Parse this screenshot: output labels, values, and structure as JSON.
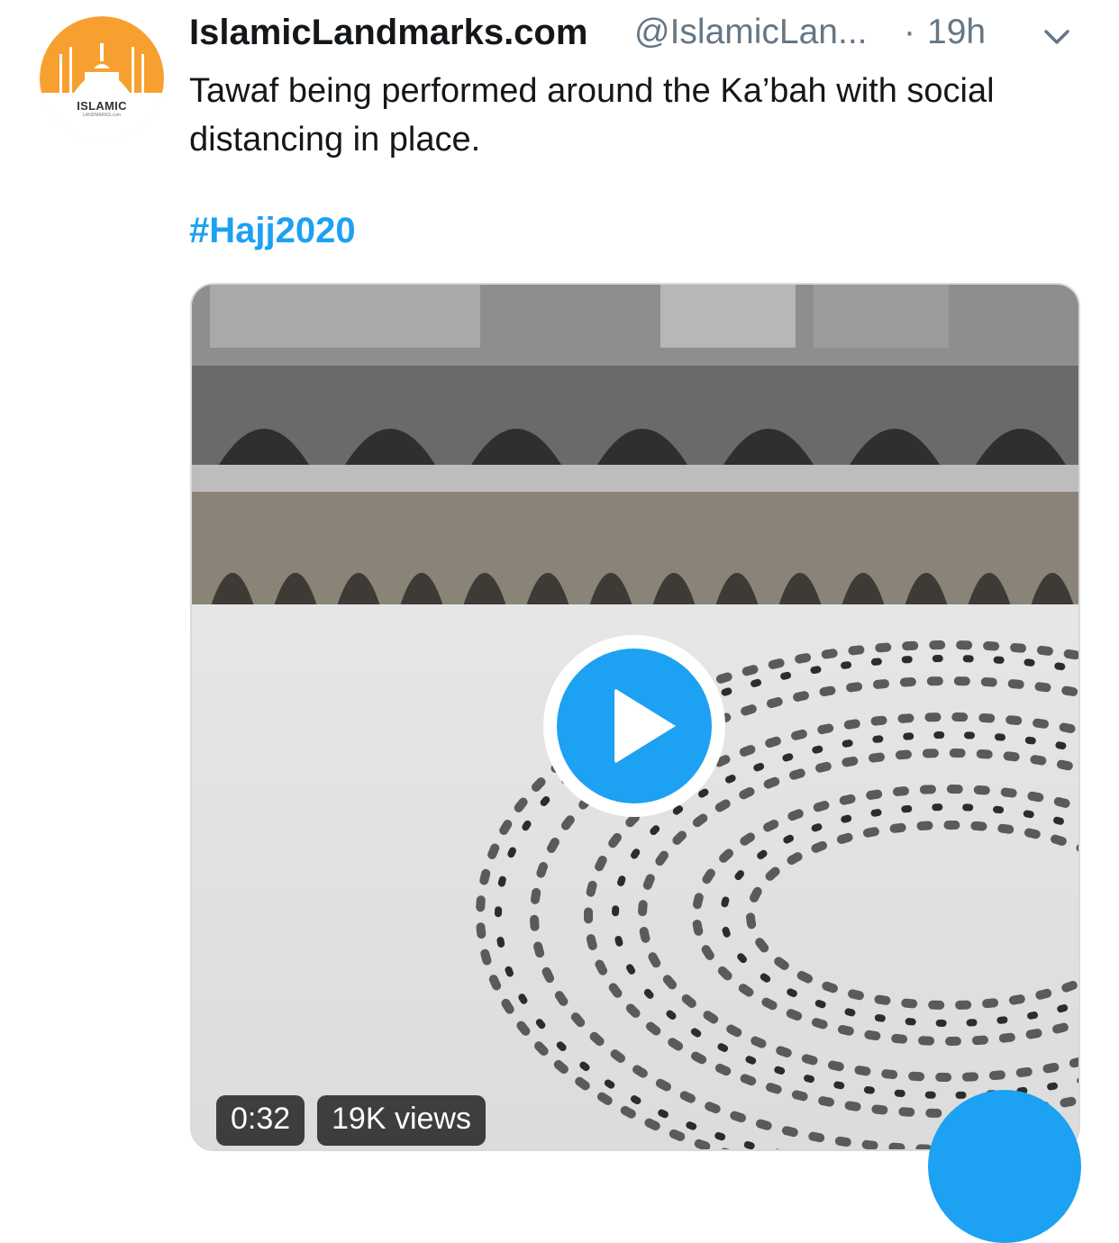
{
  "tweet": {
    "display_name": "IslamicLandmarks.com",
    "handle": "@IslamicLan...",
    "separator": "·",
    "time": "19h",
    "text": "Tawaf being performed around the Ka’bah with social distancing in place.",
    "hashtag": "#Hajj2020"
  },
  "avatar": {
    "brand_main": "ISLAMIC",
    "brand_sub": "LANDMARKS.com",
    "color": "#f7a030"
  },
  "media": {
    "duration": "0:32",
    "views": "19K views",
    "play_icon": "play-icon"
  },
  "colors": {
    "link": "#1da1f2",
    "muted": "#657786",
    "text": "#14171a"
  }
}
